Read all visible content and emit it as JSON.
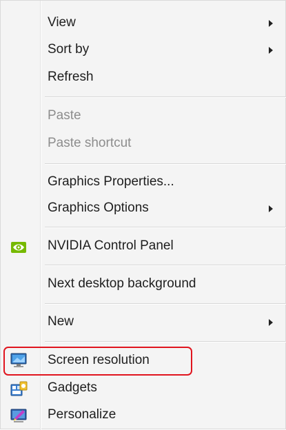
{
  "menu": {
    "items": [
      {
        "label": "View",
        "submenu": true,
        "enabled": true
      },
      {
        "label": "Sort by",
        "submenu": true,
        "enabled": true
      },
      {
        "label": "Refresh",
        "submenu": false,
        "enabled": true
      },
      {
        "label": "Paste",
        "submenu": false,
        "enabled": false
      },
      {
        "label": "Paste shortcut",
        "submenu": false,
        "enabled": false
      },
      {
        "label": "Graphics Properties...",
        "submenu": false,
        "enabled": true
      },
      {
        "label": "Graphics Options",
        "submenu": true,
        "enabled": true
      },
      {
        "label": "NVIDIA Control Panel",
        "submenu": false,
        "enabled": true,
        "icon": "nvidia-icon"
      },
      {
        "label": "Next desktop background",
        "submenu": false,
        "enabled": true
      },
      {
        "label": "New",
        "submenu": true,
        "enabled": true
      },
      {
        "label": "Screen resolution",
        "submenu": false,
        "enabled": true,
        "icon": "screen-resolution-icon",
        "highlighted": true
      },
      {
        "label": "Gadgets",
        "submenu": false,
        "enabled": true,
        "icon": "gadgets-icon"
      },
      {
        "label": "Personalize",
        "submenu": false,
        "enabled": true,
        "icon": "personalize-icon"
      }
    ]
  },
  "colors": {
    "menu_background": "#f4f4f4",
    "text": "#1e1e1e",
    "disabled_text": "#8d8d8d",
    "highlight_border": "#e0141e"
  }
}
